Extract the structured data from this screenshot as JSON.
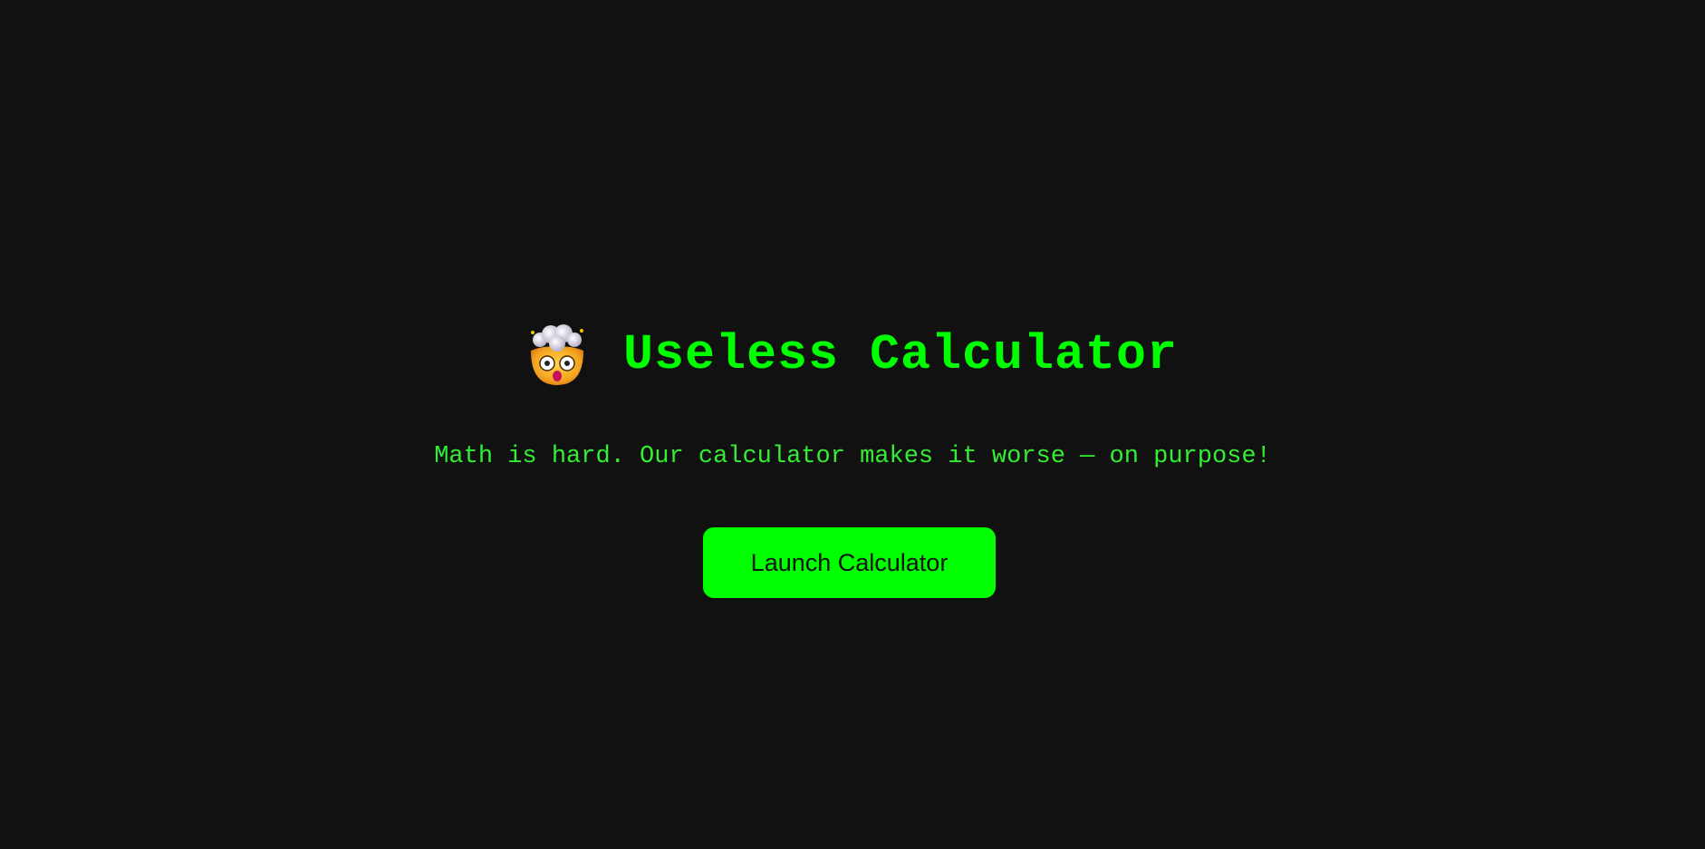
{
  "header": {
    "icon": "exploding-head-icon",
    "title": "Useless Calculator"
  },
  "hero": {
    "subtitle": "Math is hard. Our calculator makes it worse — on purpose!"
  },
  "actions": {
    "launch_label": "Launch Calculator"
  },
  "colors": {
    "background": "#111111",
    "accent": "#00ff00",
    "subtitle": "#33ee33",
    "button_text": "#111111"
  }
}
